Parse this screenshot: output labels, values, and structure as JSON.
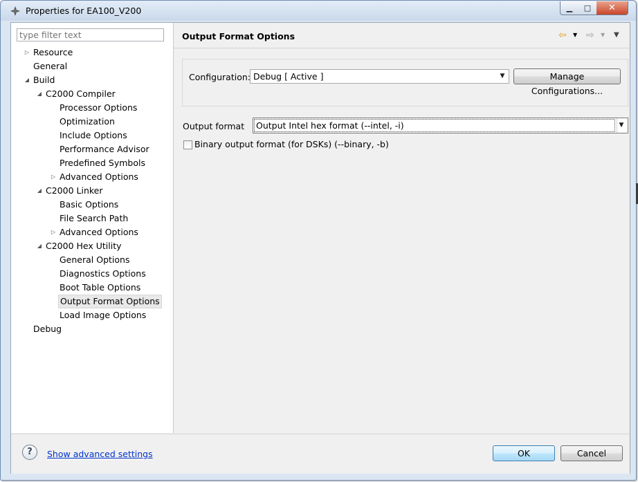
{
  "window": {
    "title": "Properties for EA100_V200",
    "controls": {
      "minimize": "▁",
      "maximize": "□",
      "close": "✕"
    }
  },
  "sidebar": {
    "filter_placeholder": "type filter text",
    "items": [
      {
        "label": "Resource",
        "level": 0,
        "toggle": "collapsed"
      },
      {
        "label": "General",
        "level": 0,
        "toggle": "none"
      },
      {
        "label": "Build",
        "level": 0,
        "toggle": "expanded"
      },
      {
        "label": "C2000 Compiler",
        "level": 1,
        "toggle": "expanded"
      },
      {
        "label": "Processor Options",
        "level": 2,
        "toggle": "none"
      },
      {
        "label": "Optimization",
        "level": 2,
        "toggle": "none"
      },
      {
        "label": "Include Options",
        "level": 2,
        "toggle": "none"
      },
      {
        "label": "Performance Advisor",
        "level": 2,
        "toggle": "none"
      },
      {
        "label": "Predefined Symbols",
        "level": 2,
        "toggle": "none"
      },
      {
        "label": "Advanced Options",
        "level": 2,
        "toggle": "collapsed"
      },
      {
        "label": "C2000 Linker",
        "level": 1,
        "toggle": "expanded"
      },
      {
        "label": "Basic Options",
        "level": 2,
        "toggle": "none"
      },
      {
        "label": "File Search Path",
        "level": 2,
        "toggle": "none"
      },
      {
        "label": "Advanced Options",
        "level": 2,
        "toggle": "collapsed"
      },
      {
        "label": "C2000 Hex Utility",
        "level": 1,
        "toggle": "expanded"
      },
      {
        "label": "General Options",
        "level": 2,
        "toggle": "none"
      },
      {
        "label": "Diagnostics Options",
        "level": 2,
        "toggle": "none"
      },
      {
        "label": "Boot Table Options",
        "level": 2,
        "toggle": "none"
      },
      {
        "label": "Output Format Options",
        "level": 2,
        "toggle": "none",
        "selected": true
      },
      {
        "label": "Load Image Options",
        "level": 2,
        "toggle": "none"
      },
      {
        "label": "Debug",
        "level": 0,
        "toggle": "none"
      }
    ]
  },
  "page": {
    "title": "Output Format Options",
    "nav": {
      "back_icon": "⇦",
      "forward_icon": "⇨",
      "menu_icon": "▼"
    },
    "configuration": {
      "label": "Configuration:",
      "value": "Debug  [ Active ]",
      "manage_button": "Manage Configurations..."
    },
    "output_format": {
      "label": "Output format",
      "value": "Output Intel hex format (--intel, -i)"
    },
    "binary_checkbox": {
      "label": "Binary output format (for DSKs) (--binary, -b)",
      "checked": false
    }
  },
  "footer": {
    "help_icon": "?",
    "advanced_link": "Show advanced settings",
    "ok_button": "OK",
    "cancel_button": "Cancel"
  },
  "colors": {
    "frame": "#dbe6f3",
    "link": "#0033cc",
    "nav_back": "#e3a21a",
    "nav_forward": "#9aa0a6"
  }
}
